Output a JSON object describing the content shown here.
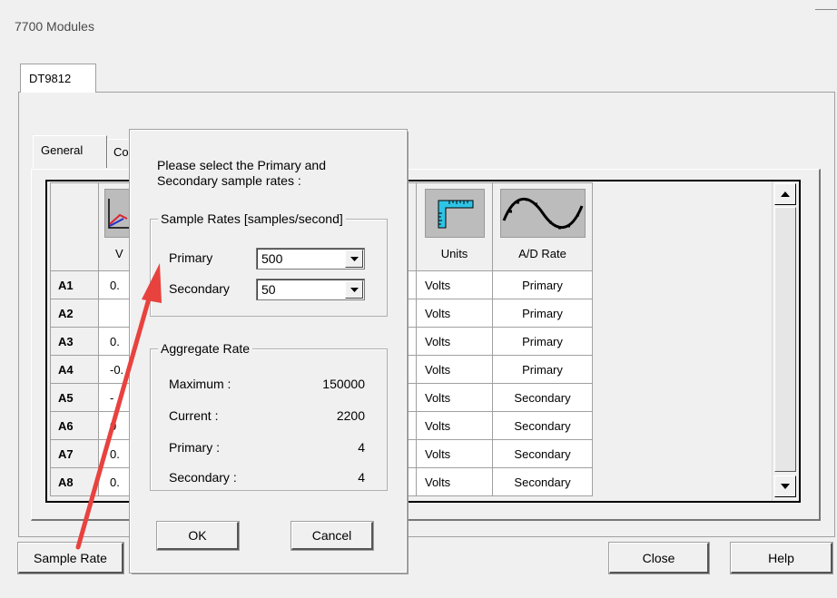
{
  "window": {
    "title": "7700 Modules"
  },
  "outer_tab": {
    "label": "DT9812"
  },
  "inner_tabs": [
    {
      "label": "General"
    },
    {
      "label": "Co"
    }
  ],
  "grid": {
    "columns": [
      {
        "label": "V",
        "icon": "graph-icon"
      },
      {
        "label": "Units",
        "icon": "ruler-icon"
      },
      {
        "label": "A/D Rate",
        "icon": "sine-wave-icon"
      }
    ],
    "rows": [
      {
        "id": "A1",
        "value": "0.",
        "units": "Volts",
        "rate": "Primary"
      },
      {
        "id": "A2",
        "value": "",
        "units": "Volts",
        "rate": "Primary"
      },
      {
        "id": "A3",
        "value": "0.",
        "units": "Volts",
        "rate": "Primary"
      },
      {
        "id": "A4",
        "value": "-0.",
        "units": "Volts",
        "rate": "Primary"
      },
      {
        "id": "A5",
        "value": "-",
        "units": "Volts",
        "rate": "Secondary"
      },
      {
        "id": "A6",
        "value": "0",
        "units": "Volts",
        "rate": "Secondary"
      },
      {
        "id": "A7",
        "value": "0.",
        "units": "Volts",
        "rate": "Secondary"
      },
      {
        "id": "A8",
        "value": "0.",
        "units": "Volts",
        "rate": "Secondary"
      }
    ]
  },
  "bottom_buttons": {
    "sample_rate": "Sample Rate",
    "close": "Close",
    "help": "Help"
  },
  "dialog": {
    "prompt_line1": "Please select the Primary and",
    "prompt_line2": "Secondary sample rates :",
    "sample_rates_group": "Sample Rates [samples/second]",
    "primary_label": "Primary",
    "primary_value": "500",
    "secondary_label": "Secondary",
    "secondary_value": "50",
    "aggregate_group": "Aggregate Rate",
    "aggregate": [
      {
        "label": "Maximum :",
        "value": "150000"
      },
      {
        "label": "Current :",
        "value": "2200"
      },
      {
        "label": "Primary :",
        "value": "4"
      },
      {
        "label": "Secondary :",
        "value": "4"
      }
    ],
    "ok": "OK",
    "cancel": "Cancel"
  },
  "colors": {
    "annotation_arrow": "#e8423f",
    "ruler_icon": "#2ec4e6"
  }
}
